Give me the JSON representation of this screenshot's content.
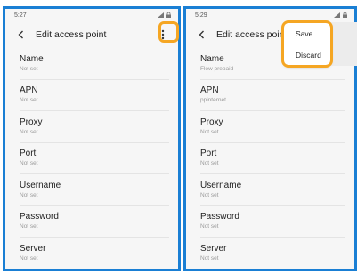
{
  "left": {
    "time": "5:27",
    "title": "Edit access point",
    "items": [
      {
        "label": "Name",
        "value": "Not set"
      },
      {
        "label": "APN",
        "value": "Not set"
      },
      {
        "label": "Proxy",
        "value": "Not set"
      },
      {
        "label": "Port",
        "value": "Not set"
      },
      {
        "label": "Username",
        "value": "Not set"
      },
      {
        "label": "Password",
        "value": "Not set"
      },
      {
        "label": "Server",
        "value": "Not set"
      }
    ]
  },
  "right": {
    "time": "5:29",
    "title": "Edit access point",
    "items": [
      {
        "label": "Name",
        "value": "Flow prepaid"
      },
      {
        "label": "APN",
        "value": "ppinternet"
      },
      {
        "label": "Proxy",
        "value": "Not set"
      },
      {
        "label": "Port",
        "value": "Not set"
      },
      {
        "label": "Username",
        "value": "Not set"
      },
      {
        "label": "Password",
        "value": "Not set"
      },
      {
        "label": "Server",
        "value": "Not set"
      }
    ],
    "menu": {
      "save": "Save",
      "discard": "Discard"
    }
  },
  "colors": {
    "frame": "#1a7fd4",
    "highlight": "#f5a623"
  },
  "icons": {
    "back": "arrow-back-icon",
    "more": "more-vertical-icon",
    "signal": "signal-icon",
    "lock": "lock-icon"
  }
}
